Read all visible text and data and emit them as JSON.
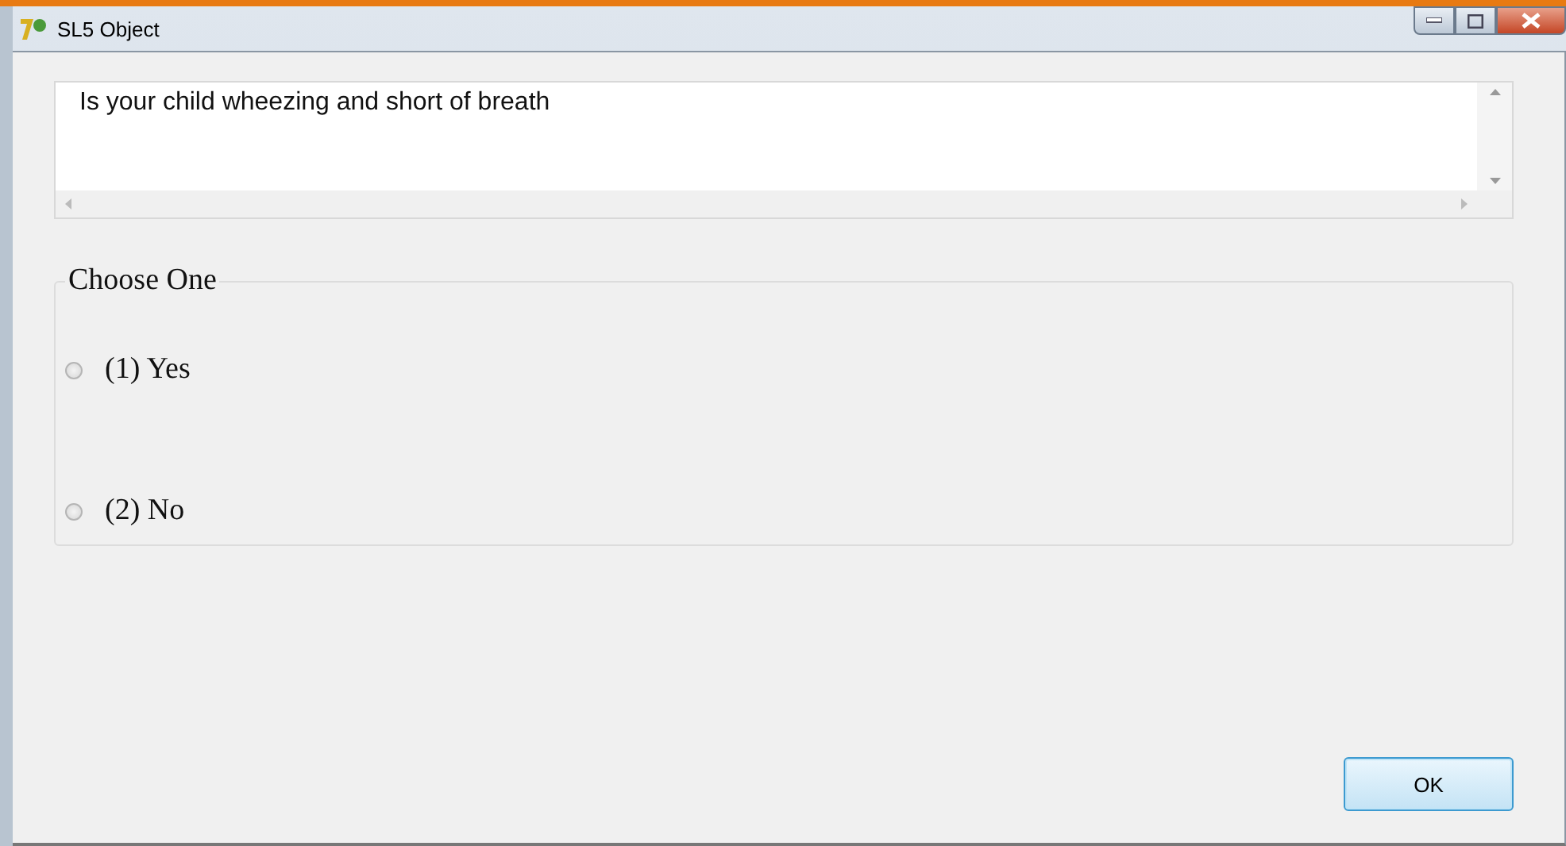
{
  "window": {
    "title": "SL5 Object"
  },
  "question": {
    "value": "Is your child wheezing and short of breath"
  },
  "choices": {
    "legend": "Choose One",
    "options": [
      {
        "label": "(1) Yes",
        "selected": false
      },
      {
        "label": "(2) No",
        "selected": false
      }
    ]
  },
  "buttons": [
    {
      "label": "OK"
    }
  ]
}
